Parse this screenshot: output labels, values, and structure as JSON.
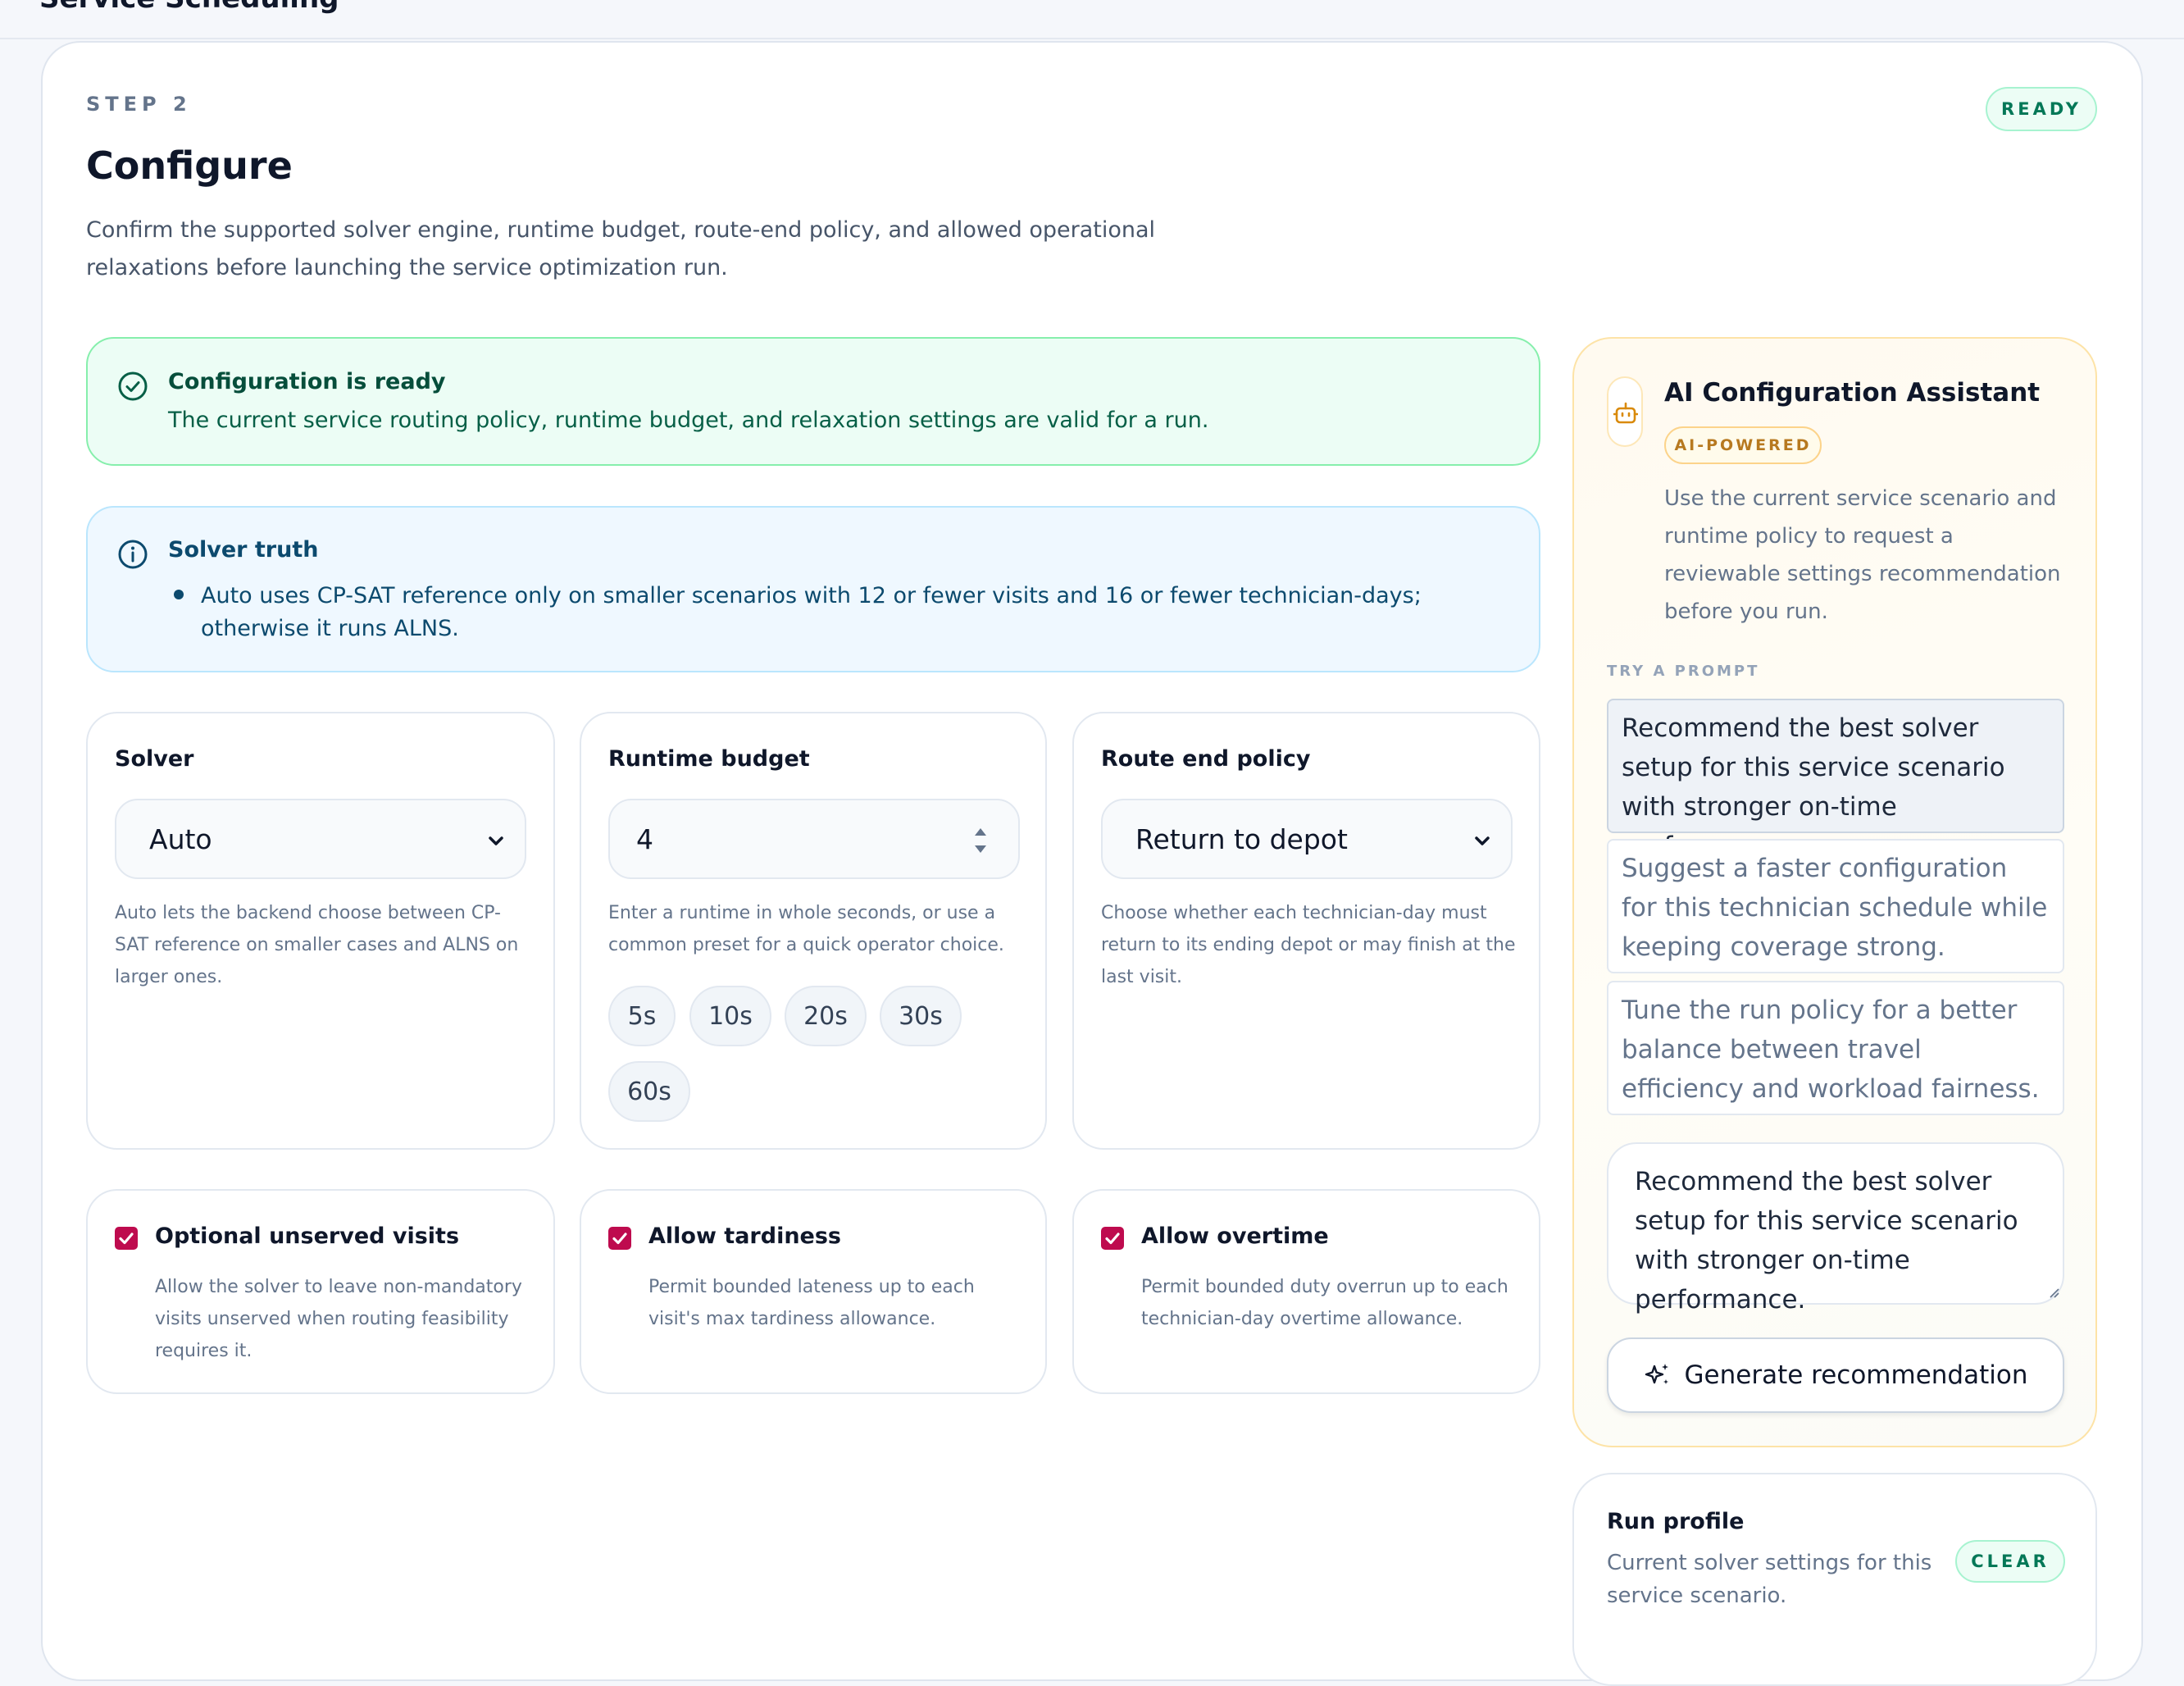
{
  "app": {
    "title": "Service Scheduling"
  },
  "step": {
    "eyebrow": "STEP 2",
    "title": "Configure",
    "description": "Confirm the supported solver engine, runtime budget, route-end policy, and allowed operational relaxations before launching the service optimization run.",
    "status": "READY"
  },
  "alerts": {
    "ready": {
      "title": "Configuration is ready",
      "body": "The current service routing policy, runtime budget, and relaxation settings are valid for a run.",
      "icon": "check-circle-icon"
    },
    "info": {
      "title": "Solver truth",
      "body": "Auto uses CP-SAT reference only on smaller scenarios with 12 or fewer visits and 16 or fewer technician-days; otherwise it runs ALNS.",
      "icon": "info-icon"
    }
  },
  "settings": {
    "solver": {
      "label": "Solver",
      "value": "Auto",
      "help": "Auto lets the backend choose between CP-SAT reference on smaller cases and ALNS on larger ones."
    },
    "runtime": {
      "label": "Runtime budget",
      "value": "4",
      "help": "Enter a runtime in whole seconds, or use a common preset for a quick operator choice.",
      "presets": [
        "5s",
        "10s",
        "20s",
        "30s",
        "60s"
      ]
    },
    "route_end": {
      "label": "Route end policy",
      "value": "Return to depot",
      "help": "Choose whether each technician-day must return to its ending depot or may finish at the last visit."
    }
  },
  "relaxations": {
    "optional": {
      "label": "Optional unserved visits",
      "checked": true,
      "help": "Allow the solver to leave non-mandatory visits unserved when routing feasibility requires it."
    },
    "tardiness": {
      "label": "Allow tardiness",
      "checked": true,
      "help": "Permit bounded lateness up to each visit's max tardiness allowance."
    },
    "overtime": {
      "label": "Allow overtime",
      "checked": true,
      "help": "Permit bounded duty overrun up to each technician-day overtime allowance."
    }
  },
  "assistant": {
    "title": "AI Configuration Assistant",
    "badge": "AI-POWERED",
    "description": "Use the current service scenario and runtime policy to request a reviewable settings recommendation before you run.",
    "try_label": "TRY A PROMPT",
    "prompts": [
      "Recommend the best solver setup for this service scenario with stronger on-time performance.",
      "Suggest a faster configuration for this technician schedule while keeping coverage strong.",
      "Tune the run policy for a better balance between travel efficiency and workload fairness."
    ],
    "input_value": "Recommend the best solver setup for this service scenario with stronger on-time performance.",
    "generate_label": "Generate recommendation",
    "icon": "robot-icon"
  },
  "run_profile": {
    "title": "Run profile",
    "description": "Current solver settings for this service scenario.",
    "status": "CLEAR"
  },
  "colors": {
    "accent_check": "#be0b4e",
    "success": "#047857",
    "ai_accent": "#b7791f"
  }
}
